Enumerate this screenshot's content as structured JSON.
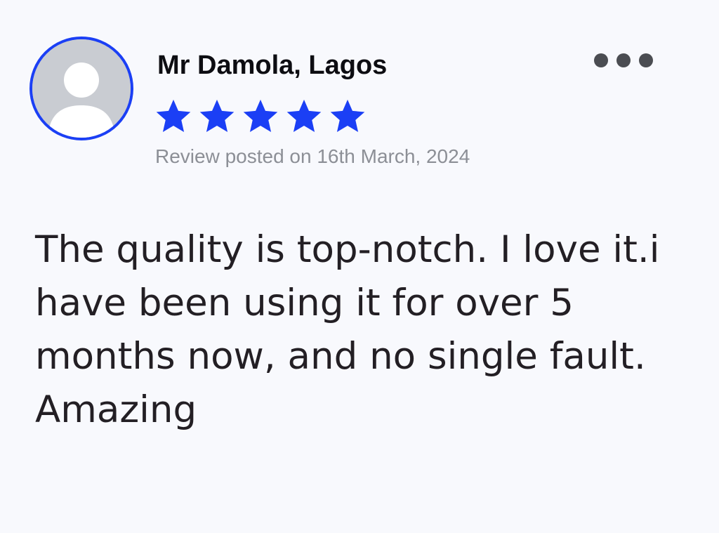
{
  "colors": {
    "accent": "#1b3ff5",
    "star": "#1b3ff5",
    "avatar_bg": "#c9ccd2"
  },
  "review": {
    "reviewer_name": "Mr Damola, Lagos",
    "rating": 5,
    "rating_max": 5,
    "posted_date": "Review posted on 16th March, 2024",
    "text": "The quality is top-notch. I love it.i have been using it for over 5 months now, and no single fault. Amazing"
  },
  "icons": {
    "avatar": "user-placeholder-icon",
    "more": "more-horizontal-icon",
    "star": "star-filled-icon"
  }
}
